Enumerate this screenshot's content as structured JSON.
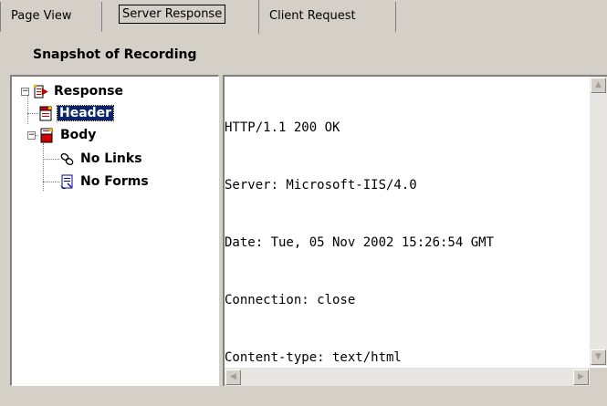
{
  "tabs": [
    {
      "label": "Page View",
      "active": false
    },
    {
      "label": "Server Response",
      "active": true
    },
    {
      "label": "Client Request",
      "active": false
    }
  ],
  "section_title": "Snapshot of Recording",
  "tree": {
    "root": {
      "label": "Response",
      "icon": "response-icon",
      "expanded": true
    },
    "header": {
      "label": "Header",
      "icon": "page-red-icon",
      "selected": true
    },
    "body": {
      "label": "Body",
      "icon": "page-red-icon",
      "expanded": true
    },
    "links": {
      "label": "No Links",
      "icon": "links-icon"
    },
    "forms": {
      "label": "No Forms",
      "icon": "forms-icon"
    }
  },
  "response_lines": [
    "HTTP/1.1 200 OK",
    "Server: Microsoft-IIS/4.0",
    "Date: Tue, 05 Nov 2002 15:26:54 GMT",
    "Connection: close",
    "Content-type: text/html"
  ],
  "colors": {
    "selection": "#0a246a",
    "face": "#d4d0c8"
  }
}
